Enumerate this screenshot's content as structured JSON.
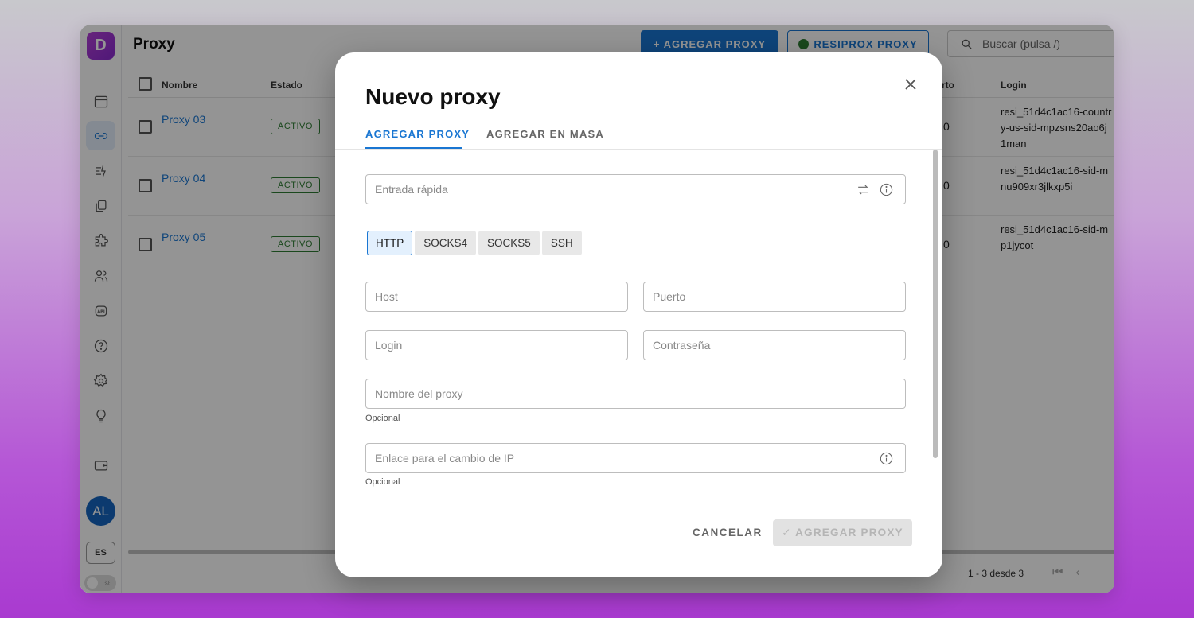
{
  "app": {
    "logo_letter": "D",
    "page_title": "Proxy",
    "add_proxy_label": "+ AGREGAR PROXY",
    "resiprox_label": "RESIPROX PROXY",
    "search_placeholder": "Buscar (pulsa /)",
    "avatar_initials": "AL",
    "language": "ES",
    "brand_color": "#1976d2",
    "sidebar_icons": [
      "browser-icon",
      "link-icon",
      "automation-icon",
      "copy-icon",
      "extensions-icon",
      "users-icon",
      "api-icon",
      "help-icon",
      "settings-icon",
      "lightbulb-icon",
      "wallet-icon"
    ]
  },
  "table": {
    "headers": {
      "name": "Nombre",
      "status": "Estado",
      "port": "rto",
      "login": "Login"
    },
    "rows": [
      {
        "name": "Proxy 03",
        "status": "ACTIVO",
        "port": "0",
        "login": "resi_51d4c1ac16-country-us-sid-mpzsns20ao6j1man"
      },
      {
        "name": "Proxy 04",
        "status": "ACTIVO",
        "port": "0",
        "login": "resi_51d4c1ac16-sid-mnu909xr3jlkxp5i"
      },
      {
        "name": "Proxy 05",
        "status": "ACTIVO",
        "port": "0",
        "login": "resi_51d4c1ac16-sid-mp1jycot"
      }
    ],
    "pagination": "1 - 3 desde 3"
  },
  "modal": {
    "title": "Nuevo proxy",
    "tabs": [
      {
        "label": "AGREGAR PROXY",
        "active": true
      },
      {
        "label": "AGREGAR EN MASA",
        "active": false
      }
    ],
    "quick_entry_placeholder": "Entrada rápida",
    "protocols": [
      {
        "label": "HTTP",
        "selected": true
      },
      {
        "label": "SOCKS4",
        "selected": false
      },
      {
        "label": "SOCKS5",
        "selected": false
      },
      {
        "label": "SSH",
        "selected": false
      }
    ],
    "host_placeholder": "Host",
    "port_placeholder": "Puerto",
    "login_placeholder": "Login",
    "password_placeholder": "Contraseña",
    "proxy_name_placeholder": "Nombre del proxy",
    "proxy_name_helper": "Opcional",
    "ip_change_placeholder": "Enlace para el cambio de IP",
    "ip_change_helper": "Opcional",
    "cancel_label": "CANCELAR",
    "submit_label": "✓ AGREGAR PROXY"
  }
}
